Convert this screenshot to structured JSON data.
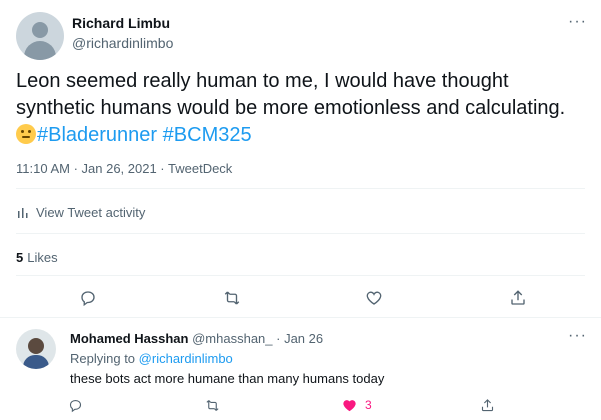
{
  "tweet": {
    "author_name": "Richard Limbu",
    "author_handle": "@richardinlimbo",
    "more_icon": "···",
    "text_part1": "Leon seemed really human to me, I would have thought synthetic humans would be more emotionless and calculating.",
    "emoji": "thinking-face",
    "hashtag1": "#Bladerunner",
    "hashtag2": "#BCM325",
    "timestamp": "11:10 AM · Jan 26, 2021 · TweetDeck",
    "activity_label": "View Tweet activity",
    "likes_count": "5",
    "likes_label": "Likes"
  },
  "reply": {
    "author_name": "Mohamed Hasshan",
    "author_handle": "@mhasshan_",
    "date": "· Jan 26",
    "more_icon": "···",
    "replying_label": "Replying to",
    "replying_to": "@richardinlimbo",
    "text": "these bots act more humane than many humans today",
    "like_count": "3"
  },
  "colors": {
    "accent": "#1d9bf0",
    "muted": "#536471",
    "like": "#f91880"
  }
}
